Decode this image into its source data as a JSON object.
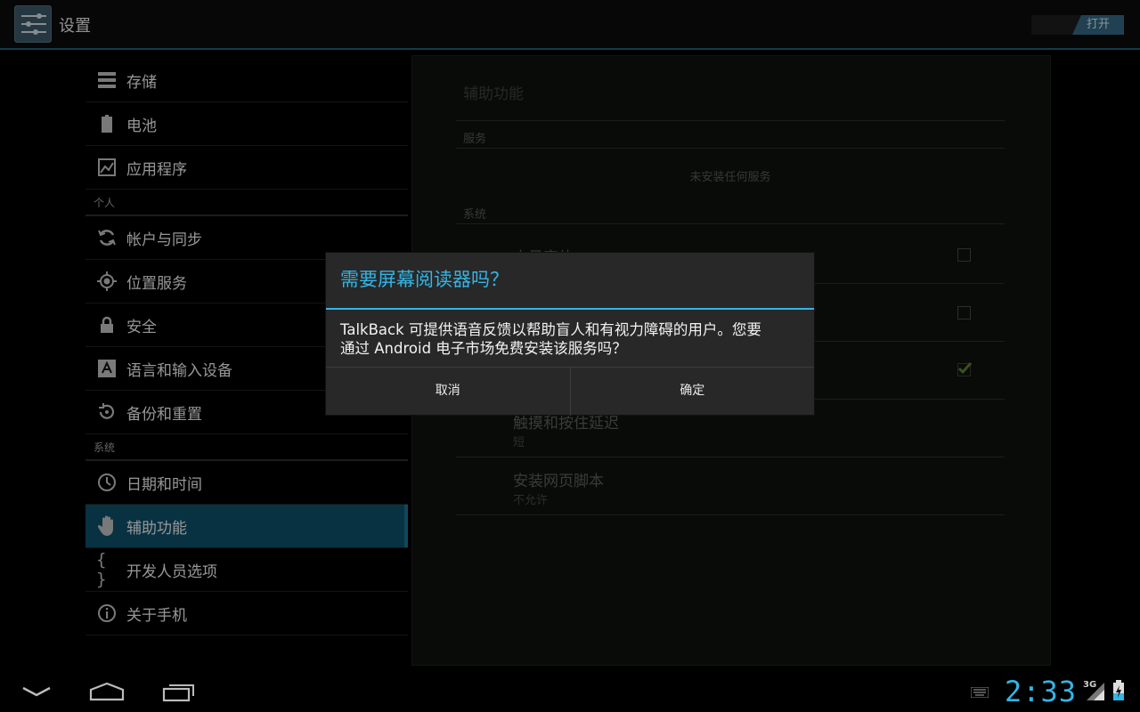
{
  "app_bar": {
    "title": "设置",
    "switch_on_label": "打开"
  },
  "nav": {
    "items_top": [
      {
        "label": "存储",
        "icon": "storage-icon"
      },
      {
        "label": "电池",
        "icon": "battery-icon"
      },
      {
        "label": "应用程序",
        "icon": "apps-icon"
      }
    ],
    "header_personal": "个人",
    "items_personal": [
      {
        "label": "帐户与同步",
        "icon": "sync-icon"
      },
      {
        "label": "位置服务",
        "icon": "location-icon"
      },
      {
        "label": "安全",
        "icon": "lock-icon"
      },
      {
        "label": "语言和输入设备",
        "icon": "language-icon"
      },
      {
        "label": "备份和重置",
        "icon": "backup-icon"
      }
    ],
    "header_system": "系统",
    "items_system": [
      {
        "label": "日期和时间",
        "icon": "clock-icon"
      },
      {
        "label": "辅助功能",
        "icon": "hand-icon",
        "active": true
      },
      {
        "label": "开发人员选项",
        "icon": "braces-icon"
      },
      {
        "label": "关于手机",
        "icon": "info-icon"
      }
    ]
  },
  "panel": {
    "title": "辅助功能",
    "category_services": "服务",
    "no_services": "未安装任何服务",
    "category_system": "系统",
    "pref_large_text": "大号字体",
    "pref_touch_delay": "触摸和按住延迟",
    "pref_touch_delay_value": "短",
    "pref_web_scripts": "安装网页脚本",
    "pref_web_scripts_value": "不允许"
  },
  "dialog": {
    "title": "需要屏幕阅读器吗？",
    "message_line1": "TalkBack 可提供语音反馈以帮助盲人和有视力障碍的用户。您要",
    "message_line2": "通过 Android 电子市场免费安装该服务吗？",
    "cancel": "取消",
    "ok": "确定"
  },
  "status": {
    "clock": "2:33",
    "network": "3G"
  },
  "colors": {
    "accent": "#33b5e5",
    "active_nav": "#0d4d66"
  }
}
